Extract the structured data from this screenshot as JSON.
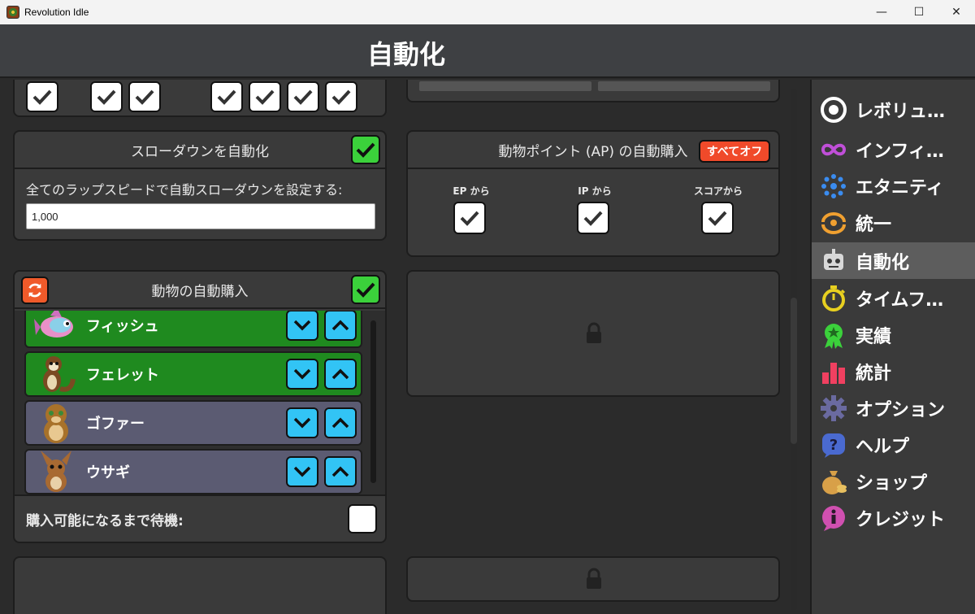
{
  "window": {
    "title": "Revolution Idle",
    "minimize": "—",
    "maximize": "☐",
    "close": "✕"
  },
  "header": {
    "title": "自動化"
  },
  "slowdown": {
    "title": "スローダウンを自動化",
    "desc": "全てのラップスピードで自動スローダウンを設定する:",
    "input_value": "1,000",
    "enabled": true
  },
  "ap_autobuy": {
    "title": "動物ポイント (AP) の自動購入",
    "all_off_label": "すべてオフ",
    "options": [
      {
        "label": "EP から",
        "checked": true
      },
      {
        "label": "IP から",
        "checked": true
      },
      {
        "label": "スコアから",
        "checked": true
      }
    ]
  },
  "animal_autobuy": {
    "title": "動物の自動購入",
    "enabled": true,
    "animals": [
      {
        "name": "フィッシュ",
        "icon": "fish-icon",
        "state": "green"
      },
      {
        "name": "フェレット",
        "icon": "ferret-icon",
        "state": "green"
      },
      {
        "name": "ゴファー",
        "icon": "gopher-icon",
        "state": "gray"
      },
      {
        "name": "ウサギ",
        "icon": "rabbit-icon",
        "state": "gray"
      }
    ],
    "wait_label": "購入可能になるまで待機:",
    "wait_checked": false
  },
  "sidebar": {
    "items": [
      {
        "label": "レボリュ…",
        "icon": "revolution-icon",
        "color": "#ffffff",
        "active": false
      },
      {
        "label": "インフィ…",
        "icon": "infinity-icon",
        "color": "#c04fd8",
        "active": false
      },
      {
        "label": "エタニティ",
        "icon": "eternity-icon",
        "color": "#3a8cf0",
        "active": false
      },
      {
        "label": "統一",
        "icon": "unity-icon",
        "color": "#f0a030",
        "active": false
      },
      {
        "label": "自動化",
        "icon": "robot-icon",
        "color": "#d8d8d8",
        "active": true
      },
      {
        "label": "タイムフ…",
        "icon": "stopwatch-icon",
        "color": "#e8d020",
        "active": false
      },
      {
        "label": "実績",
        "icon": "medal-icon",
        "color": "#3bd13b",
        "active": false
      },
      {
        "label": "統計",
        "icon": "bar-chart-icon",
        "color": "#f04060",
        "active": false
      },
      {
        "label": "オプション",
        "icon": "gear-icon",
        "color": "#6a6aa0",
        "active": false
      },
      {
        "label": "ヘルプ",
        "icon": "help-icon",
        "color": "#4a6ad0",
        "active": false
      },
      {
        "label": "ショップ",
        "icon": "money-bag-icon",
        "color": "#d8a048",
        "active": false
      },
      {
        "label": "クレジット",
        "icon": "info-icon",
        "color": "#d050b0",
        "active": false
      }
    ]
  },
  "colors": {
    "accent_green": "#3bd13b",
    "arrow_blue": "#32c4f5",
    "all_off_red": "#f04a2a",
    "reload_orange": "#f05a2a"
  }
}
